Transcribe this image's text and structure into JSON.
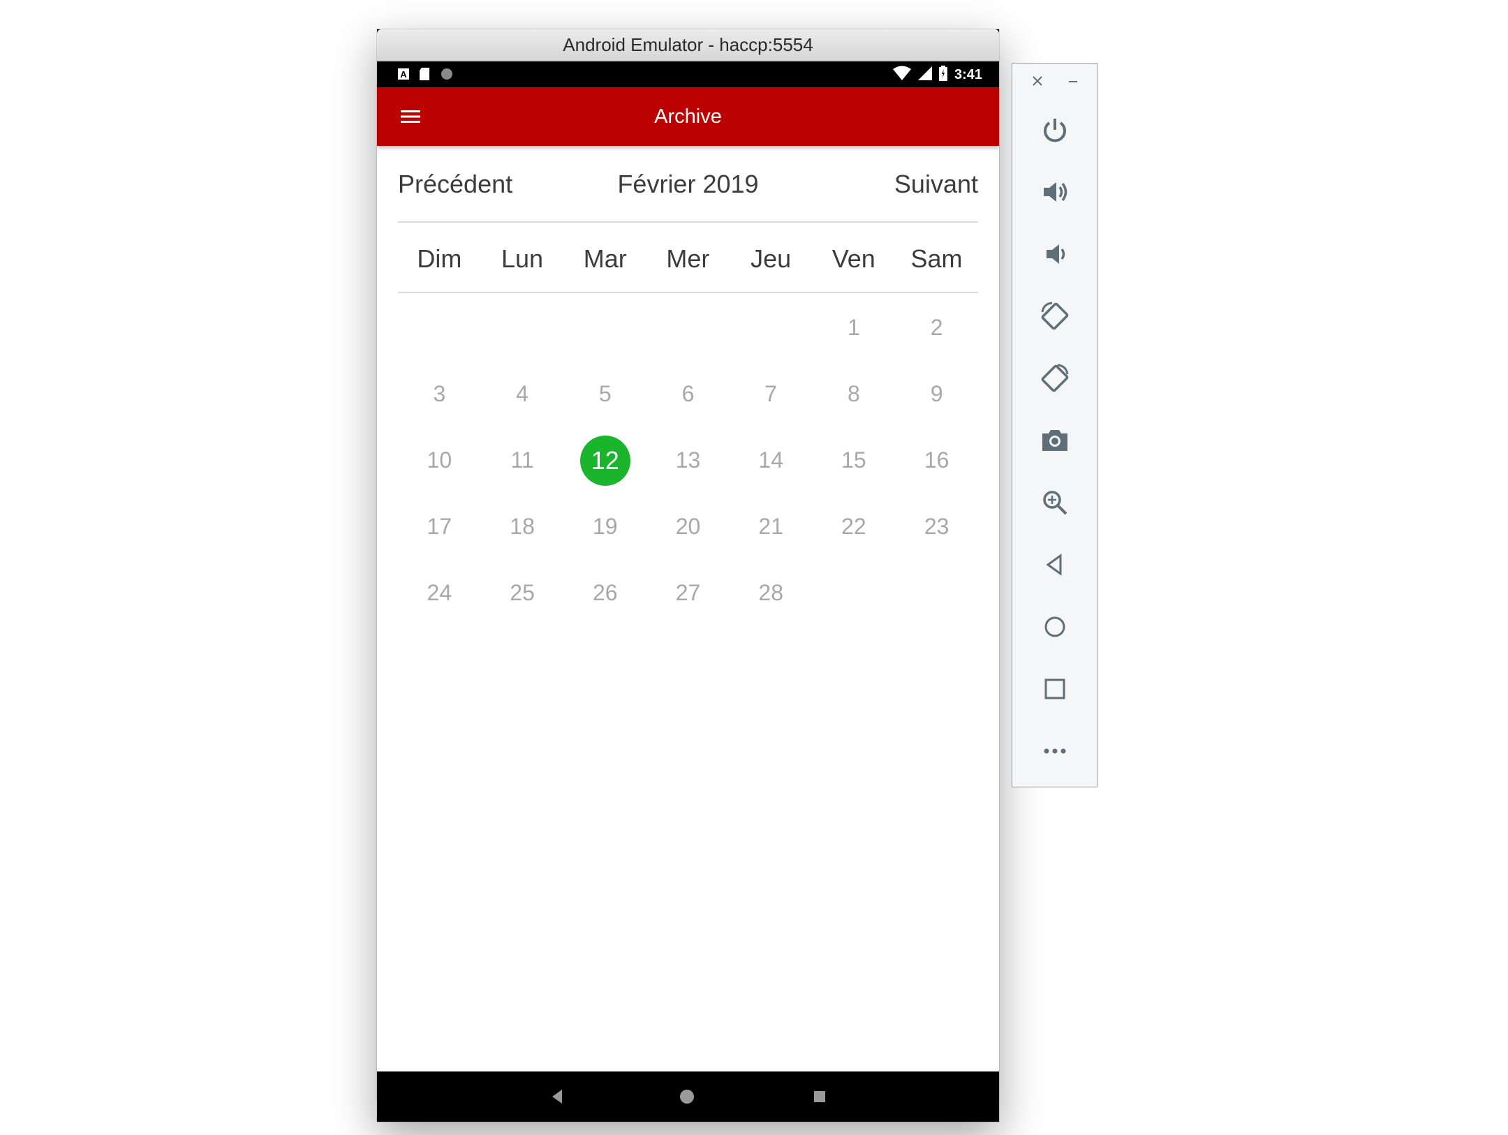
{
  "window": {
    "title": "Android Emulator - haccp:5554"
  },
  "status_bar": {
    "time": "3:41",
    "icons": [
      "notification-a-icon",
      "sd-card-icon",
      "sync-dot-icon",
      "wifi-icon",
      "signal-icon",
      "battery-icon"
    ]
  },
  "toolbar": {
    "title": "Archive",
    "menu_icon": "hamburger-menu-icon",
    "color": "#bb0000"
  },
  "calendar": {
    "prev_label": "Précédent",
    "month_label": "Février 2019",
    "next_label": "Suivant",
    "weekdays": [
      "Dim",
      "Lun",
      "Mar",
      "Mer",
      "Jeu",
      "Ven",
      "Sam"
    ],
    "days": [
      "",
      "",
      "",
      "",
      "",
      "1",
      "2",
      "3",
      "4",
      "5",
      "6",
      "7",
      "8",
      "9",
      "10",
      "11",
      "12",
      "13",
      "14",
      "15",
      "16",
      "17",
      "18",
      "19",
      "20",
      "21",
      "22",
      "23",
      "24",
      "25",
      "26",
      "27",
      "28",
      "",
      ""
    ],
    "selected_day": "12",
    "selected_color": "#1bb52d"
  },
  "nav_bar": {
    "buttons": [
      "back-triangle-icon",
      "home-circle-icon",
      "recents-square-icon"
    ]
  },
  "side_toolbar": {
    "window_controls": [
      "close-icon",
      "minimize-icon"
    ],
    "buttons": [
      "power-icon",
      "volume-up-icon",
      "volume-down-icon",
      "rotate-left-icon",
      "rotate-right-icon",
      "camera-icon",
      "zoom-icon",
      "back-icon",
      "home-icon",
      "overview-icon",
      "more-icon"
    ]
  }
}
